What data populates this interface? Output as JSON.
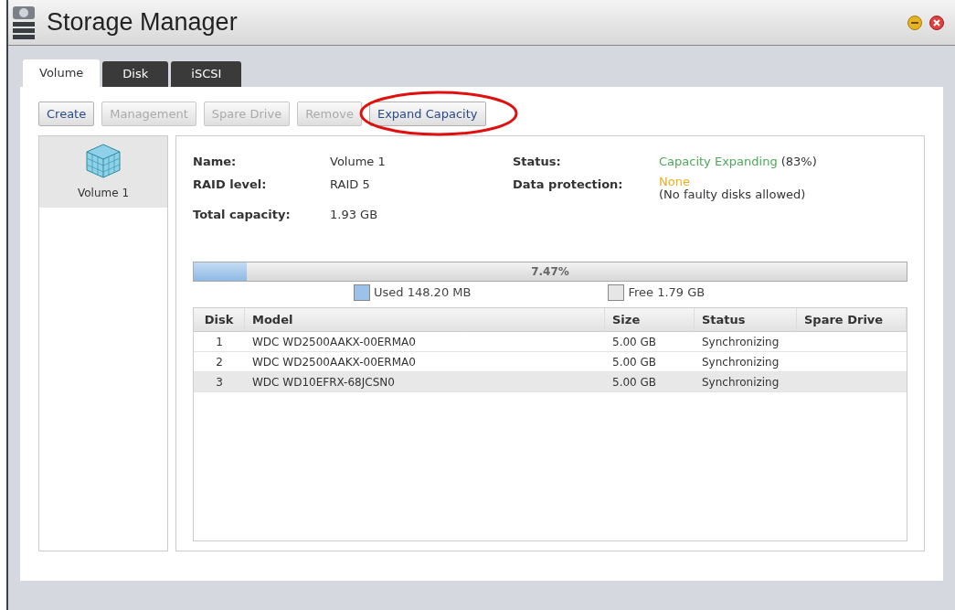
{
  "window": {
    "title": "Storage Manager"
  },
  "tabs": [
    {
      "label": "Volume",
      "selected": true
    },
    {
      "label": "Disk",
      "selected": false
    },
    {
      "label": "iSCSI",
      "selected": false
    }
  ],
  "toolbar": [
    {
      "label": "Create",
      "disabled": false,
      "highlighted": false
    },
    {
      "label": "Management",
      "disabled": true,
      "highlighted": false
    },
    {
      "label": "Spare Drive",
      "disabled": true,
      "highlighted": false
    },
    {
      "label": "Remove",
      "disabled": true,
      "highlighted": false
    },
    {
      "label": "Expand Capacity",
      "disabled": false,
      "highlighted": true
    }
  ],
  "volumes": [
    {
      "label": "Volume 1",
      "selected": true
    }
  ],
  "details": {
    "name_label": "Name:",
    "name": "Volume 1",
    "raid_label": "RAID level:",
    "raid": "RAID 5",
    "capacity_label": "Total capacity:",
    "capacity": "1.93 GB",
    "status_label": "Status:",
    "status": "Capacity Expanding",
    "status_pct": "(83%)",
    "protection_label": "Data protection:",
    "protection": "None",
    "protection_note": "(No faulty disks allowed)"
  },
  "usage": {
    "level": 0.0747,
    "reading": "7.47%",
    "used": "Used 148.20 MB",
    "free": "Free 1.79 GB"
  },
  "table": {
    "columns": [
      "Disk",
      "Model",
      "Size",
      "Status",
      "Spare Drive"
    ],
    "rows": [
      {
        "cells": [
          "1",
          "WDC WD2500AAKX-00ERMA0",
          "5.00 GB",
          "Synchronizing"
        ],
        "selected": false
      },
      {
        "cells": [
          "2",
          "WDC WD2500AAKX-00ERMA0",
          "5.00 GB",
          "Synchronizing"
        ],
        "selected": false
      },
      {
        "cells": [
          "3",
          "WDC WD10EFRX-68JCSN0",
          "5.00 GB",
          "Synchronizing"
        ],
        "selected": true
      }
    ]
  }
}
